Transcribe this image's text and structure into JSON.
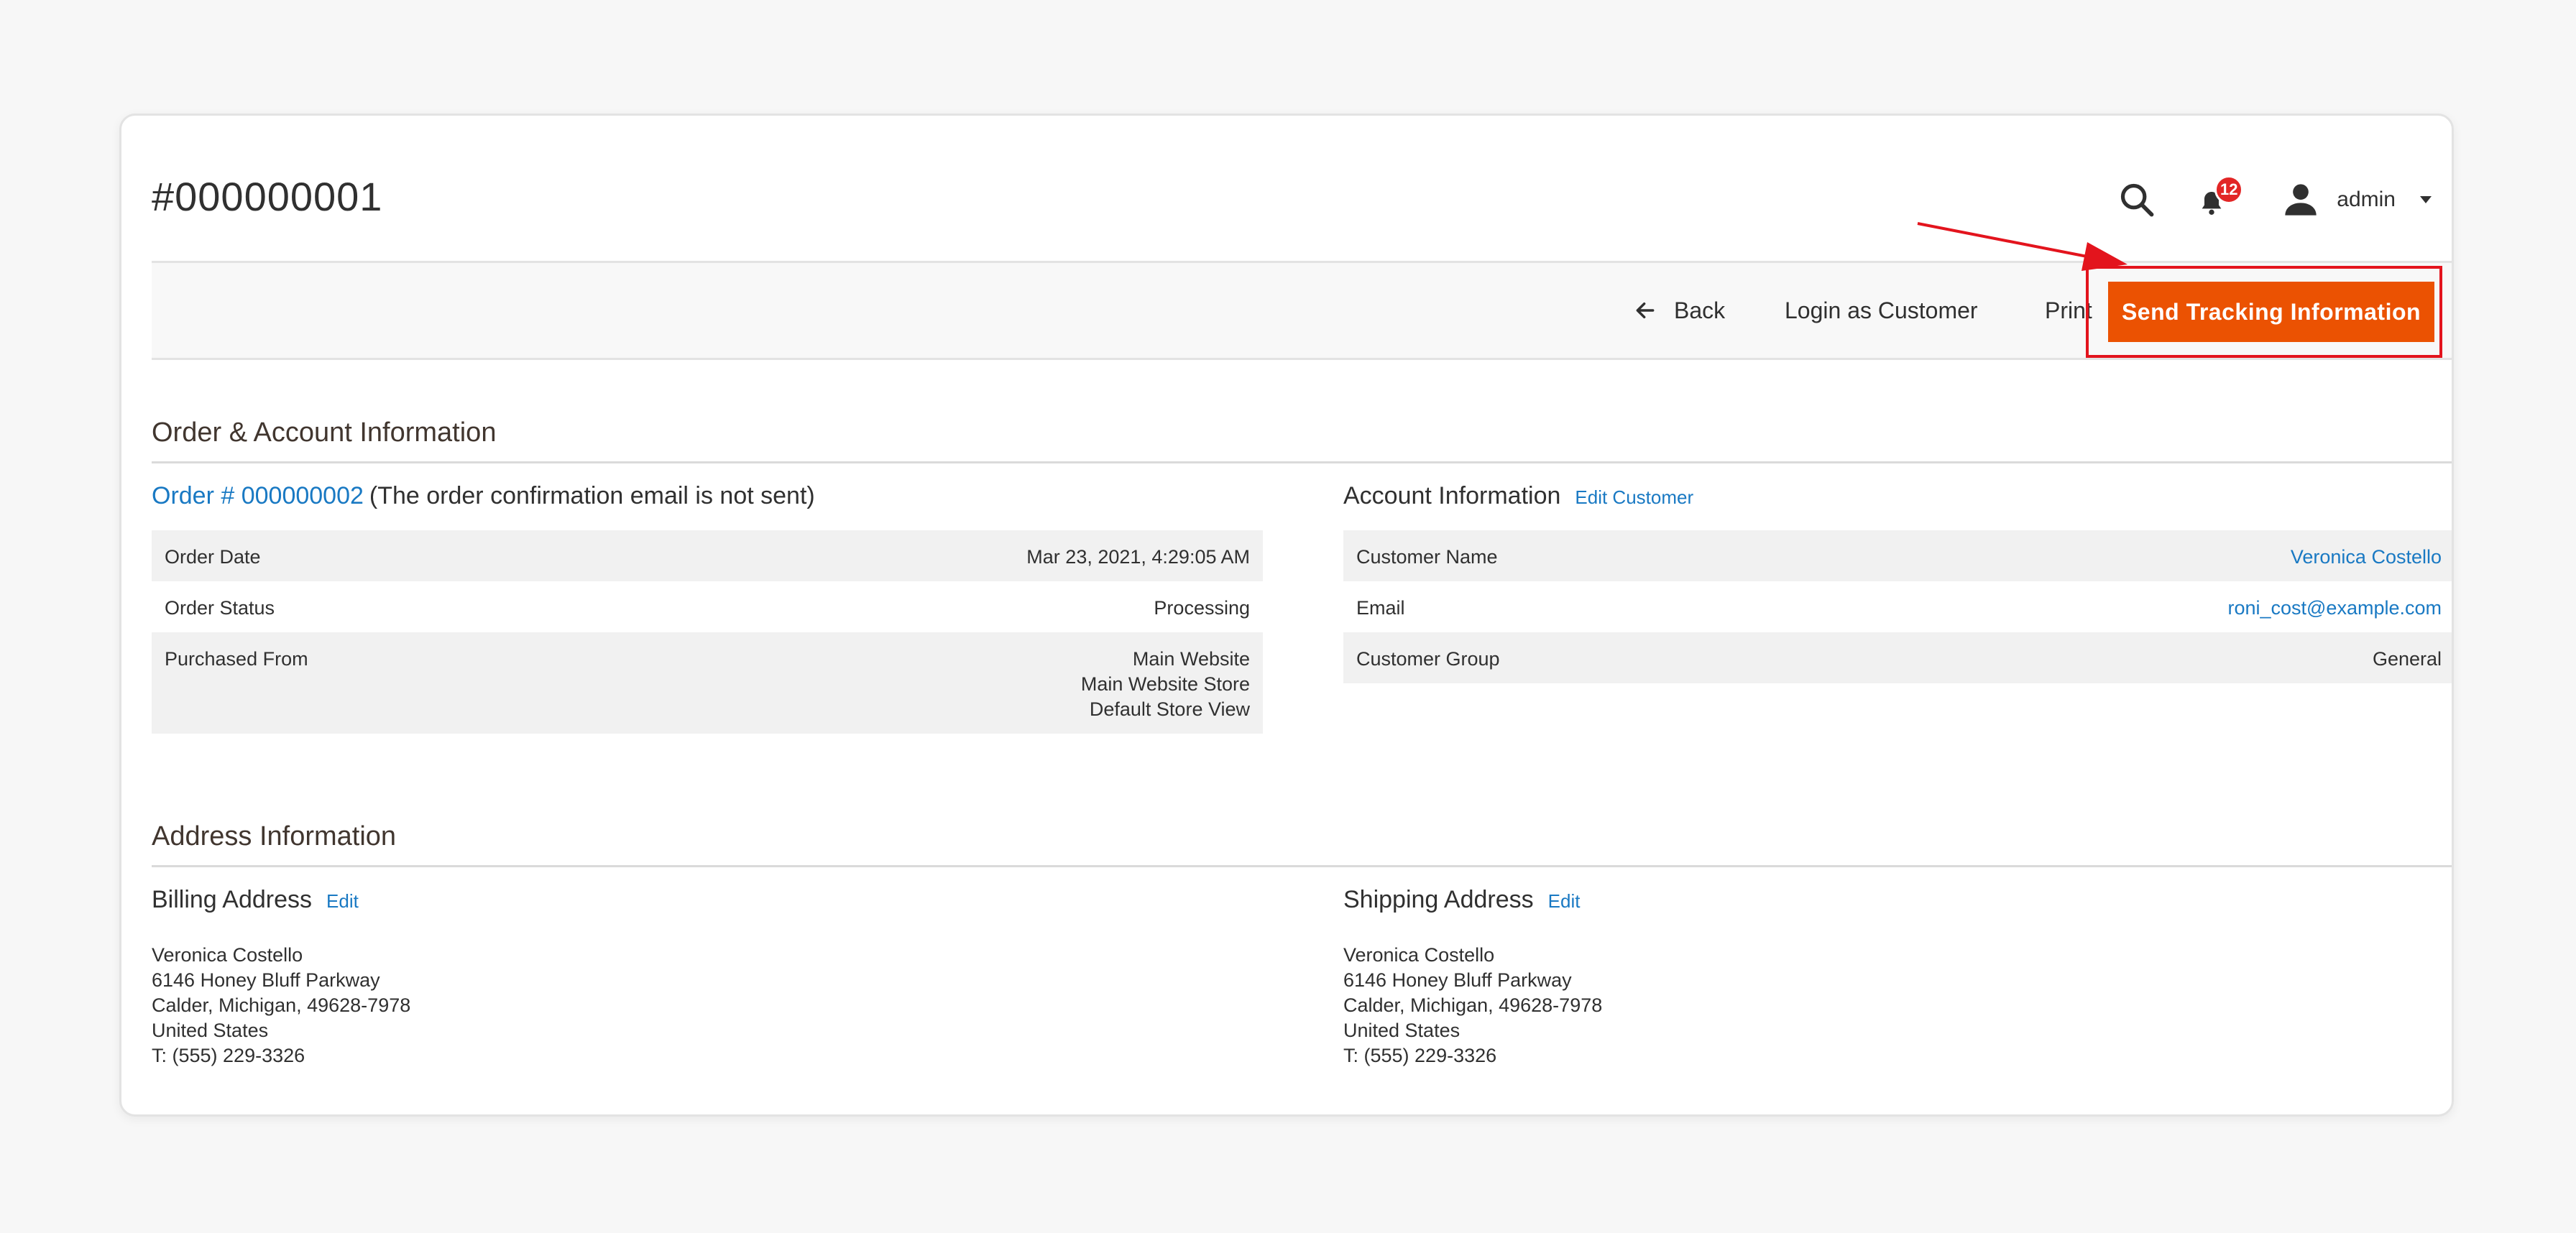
{
  "header": {
    "title": "#000000001",
    "notification_count": "12",
    "user_name": "admin"
  },
  "toolbar": {
    "back_label": "Back",
    "login_label": "Login as Customer",
    "print_label": "Print",
    "send_label": "Send Tracking Information"
  },
  "order_section": {
    "title": "Order & Account Information",
    "order_link": "Order # 000000002",
    "order_note": "(The order confirmation email is not sent)",
    "rows": [
      {
        "label": "Order Date",
        "value": "Mar 23, 2021, 4:29:05 AM"
      },
      {
        "label": "Order Status",
        "value": "Processing"
      },
      {
        "label": "Purchased From",
        "value_lines": [
          "Main Website",
          "Main Website Store",
          "Default Store View"
        ]
      }
    ]
  },
  "account_section": {
    "title": "Account Information",
    "edit_label": "Edit Customer",
    "rows": [
      {
        "label": "Customer Name",
        "value": "Veronica Costello"
      },
      {
        "label": "Email",
        "value": "roni_cost@example.com"
      },
      {
        "label": "Customer Group",
        "value": "General"
      }
    ]
  },
  "address_section": {
    "title": "Address Information",
    "billing": {
      "title": "Billing Address",
      "edit_label": "Edit",
      "lines": [
        "Veronica Costello",
        "6146 Honey Bluff Parkway",
        "Calder, Michigan, 49628-7978",
        "United States",
        "T: (555) 229-3326"
      ]
    },
    "shipping": {
      "title": "Shipping Address",
      "edit_label": "Edit",
      "lines": [
        "Veronica Costello",
        "6146 Honey Bluff Parkway",
        "Calder, Michigan, 49628-7978",
        "United States",
        "T: (555) 229-3326"
      ]
    }
  },
  "colors": {
    "accent": "#eb5202",
    "link": "#1979c3",
    "annotation": "#e3141d",
    "badge": "#e22626"
  },
  "icons": [
    "search-icon",
    "bell-icon",
    "user-icon",
    "chevron-down-icon",
    "arrow-left-icon"
  ]
}
